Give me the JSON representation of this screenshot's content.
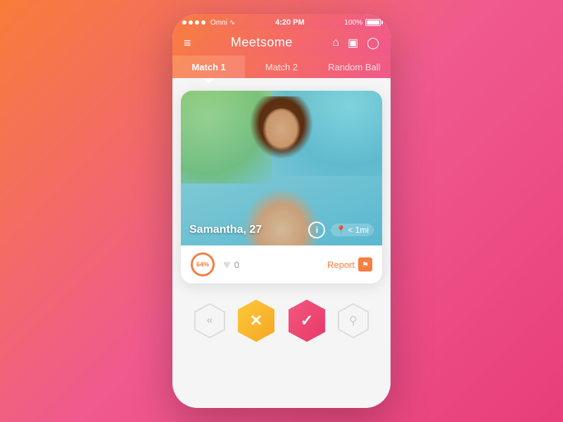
{
  "statusBar": {
    "carrier": "Omni",
    "time": "4:20 PM",
    "battery": "100%"
  },
  "navbar": {
    "title": "Meetsome",
    "hamburger": "≡",
    "icons": {
      "home": "⌂",
      "message": "☐",
      "bell": "🔔"
    }
  },
  "tabs": [
    {
      "id": "match1",
      "label": "Match 1",
      "active": true
    },
    {
      "id": "match2",
      "label": "Match 2",
      "active": false
    },
    {
      "id": "random",
      "label": "Random Ball",
      "active": false
    }
  ],
  "card": {
    "name": "Samantha, 27",
    "distance": "< 1mi",
    "matchPercent": "64%",
    "heartCount": "0",
    "reportLabel": "Report",
    "infoSymbol": "i"
  },
  "actions": {
    "back": "«",
    "dislike": "✕",
    "like": "✓",
    "location": "⚲"
  }
}
